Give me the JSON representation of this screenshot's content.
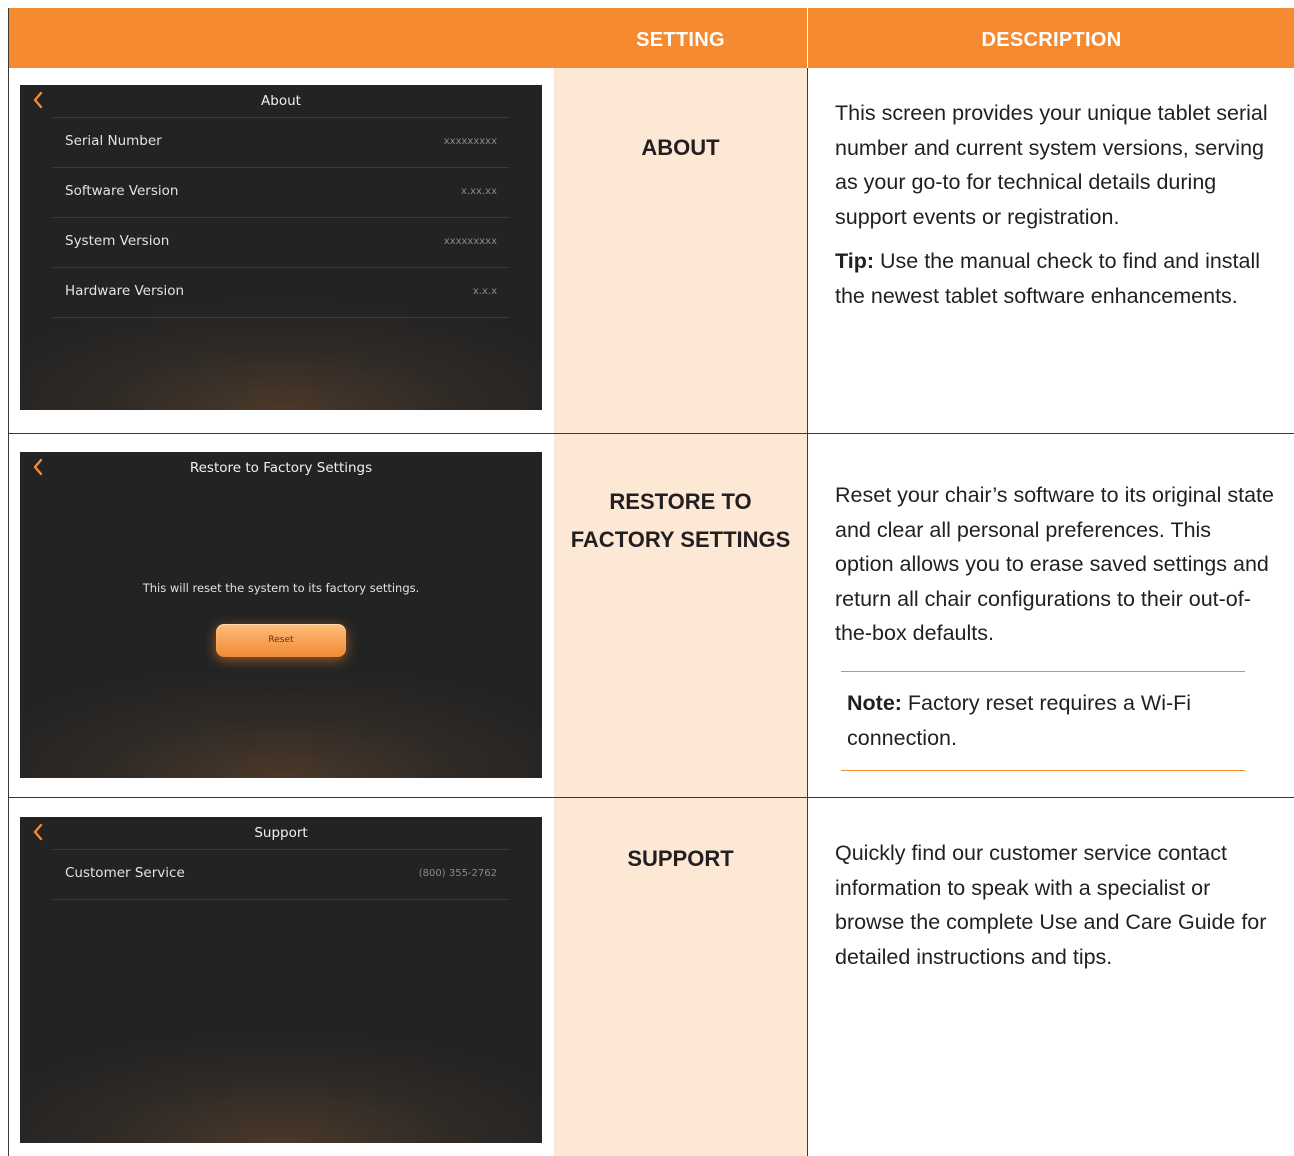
{
  "header": {
    "setting_label": "SETTING",
    "description_label": "DESCRIPTION"
  },
  "rows": [
    {
      "setting_name": "ABOUT",
      "description": "This screen provides your unique tablet serial number and current system versions, serving as your go-to for technical details during support events or registration.",
      "tip_label": "Tip:",
      "tip_text": " Use the manual check to find and install the newest tablet software enhancements.",
      "screen": {
        "title": "About",
        "items": [
          {
            "label": "Serial Number",
            "value": "xxxxxxxxx"
          },
          {
            "label": "Software Version",
            "value": "x.xx.xx"
          },
          {
            "label": "System Version",
            "value": "xxxxxxxxx"
          },
          {
            "label": "Hardware Version",
            "value": "x.x.x"
          }
        ]
      }
    },
    {
      "setting_name_line1": "RESTORE TO",
      "setting_name_line2": "FACTORY SETTINGS",
      "description": "Reset your chair’s software to its original state and clear all personal preferences. This option allows you to erase saved settings and return all chair configurations to their out-of-the-box defaults.",
      "note_label": "Note:",
      "note_text": " Factory reset requires a Wi-Fi connection.",
      "screen": {
        "title": "Restore to Factory Settings",
        "message": "This will reset the system to its factory settings.",
        "button_label": "Reset"
      }
    },
    {
      "setting_name": "SUPPORT",
      "description": "Quickly find our customer service contact information to speak with a specialist or browse the complete Use and Care Guide for detailed instructions and tips.",
      "screen": {
        "title": "Support",
        "items": [
          {
            "label": "Customer Service",
            "value": "(800) 355-2762"
          }
        ]
      }
    }
  ],
  "icons": {
    "back": "chevron-left-icon"
  },
  "colors": {
    "accent": "#f58a30",
    "setting_column_bg": "#fde8d6",
    "screen_bg": "#232323"
  }
}
